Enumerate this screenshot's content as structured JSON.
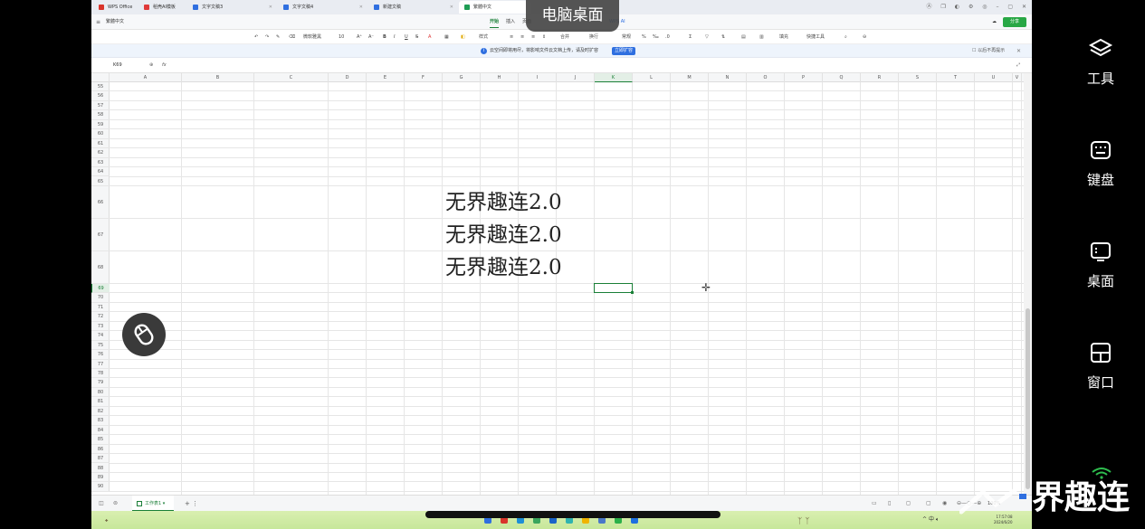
{
  "overlay": {
    "title": "电脑桌面",
    "side_items": [
      {
        "label": "工具",
        "icon": "layers-icon"
      },
      {
        "label": "键盘",
        "icon": "keyboard-icon"
      },
      {
        "label": "桌面",
        "icon": "desktop-icon"
      },
      {
        "label": "窗口",
        "icon": "window-grid-icon"
      }
    ],
    "brand_text": "界趣连"
  },
  "tabs": [
    {
      "label": "WPS Office",
      "color": "#d9342b"
    },
    {
      "label": "稻壳AI模板",
      "color": "#e03a3a"
    },
    {
      "label": "文字文稿3",
      "color": "#2f6fe0"
    },
    {
      "label": "文字文稿4",
      "color": "#2f6fe0"
    },
    {
      "label": "新建文稿",
      "color": "#2f6fe0"
    },
    {
      "label": "繁體中文",
      "color": "#1f9d55"
    }
  ],
  "menu": {
    "file_name": "繁體中文",
    "items": [
      "开始",
      "插入",
      "页面"
    ],
    "wps_ai": "WPS AI",
    "share": "分享"
  },
  "toolbar": {
    "font_name": "微软雅黑",
    "font_size": "10",
    "style_label": "样式",
    "merge_label": "合并",
    "wrap_label": "换行",
    "format_label": "常规",
    "fill_label": "填充",
    "quick_tools": "快捷工具"
  },
  "infobar": {
    "message": "云空间即将用尽，将影响文件云文档上传，请及时扩容",
    "button": "立即扩容",
    "no_remind": "以后不再提示"
  },
  "formula_bar": {
    "cell_ref": "K69",
    "fx": "fx"
  },
  "grid": {
    "columns": [
      "A",
      "B",
      "C",
      "D",
      "E",
      "F",
      "G",
      "H",
      "I",
      "J",
      "K",
      "L",
      "M",
      "N",
      "O",
      "P",
      "Q",
      "R",
      "S",
      "T",
      "U",
      "V"
    ],
    "selected_column": "K",
    "rows": [
      "55",
      "56",
      "57",
      "58",
      "59",
      "60",
      "61",
      "62",
      "63",
      "64",
      "65",
      "66",
      "67",
      "68",
      "69",
      "70",
      "71",
      "72",
      "73",
      "74",
      "75",
      "76",
      "77",
      "78",
      "79",
      "80",
      "81",
      "82",
      "83",
      "84",
      "85",
      "86",
      "87",
      "88",
      "89",
      "90"
    ],
    "selected_row": "69",
    "cell_texts": [
      "无界趣连2.0",
      "无界趣连2.0",
      "无界趣连2.0"
    ]
  },
  "sheetbar": {
    "sheet_name": "工作表1",
    "zoom": "100%"
  },
  "taskbar": {
    "time": "17:57:08",
    "date": "2024/6/20",
    "tray_lang": "中",
    "tray_ime": "英"
  }
}
